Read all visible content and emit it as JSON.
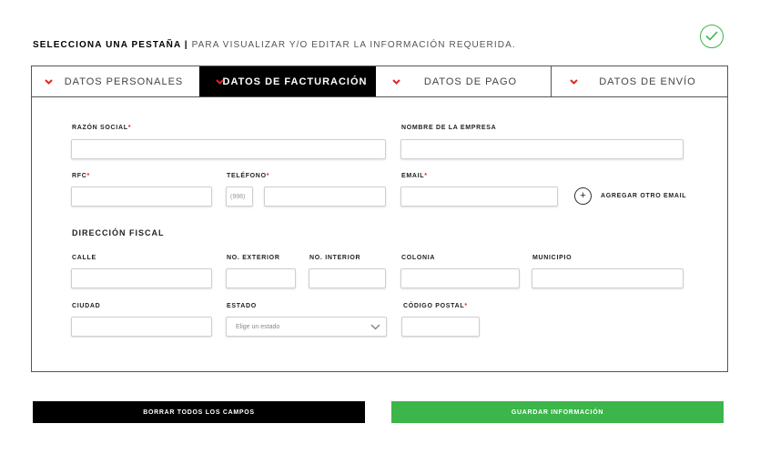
{
  "header": {
    "title": "SELECCIONA UNA PESTAÑA",
    "separator": " | ",
    "subtitle": "PARA VISUALIZAR Y/O EDITAR LA INFORMACIÓN REQUERIDA."
  },
  "tabs": [
    {
      "label": "DATOS PERSONALES",
      "active": false
    },
    {
      "label": "DATOS DE FACTURACIÓN",
      "active": true
    },
    {
      "label": "DATOS DE PAGO",
      "active": false
    },
    {
      "label": "DATOS DE ENVÍO",
      "active": false
    }
  ],
  "form": {
    "razon_social": {
      "label": "RAZÓN SOCIAL",
      "required": "*",
      "value": ""
    },
    "nombre_empresa": {
      "label": "NOMBRE DE LA EMPRESA",
      "value": ""
    },
    "rfc": {
      "label": "RFC",
      "required": "*",
      "value": ""
    },
    "telefono": {
      "label": "TELÉFONO",
      "required": "*",
      "area_placeholder": "(998)",
      "value": ""
    },
    "email": {
      "label": "EMAIL",
      "required": "*",
      "value": ""
    },
    "add_email_label": "AGREGAR OTRO EMAIL",
    "add_email_symbol": "+",
    "direccion_fiscal": {
      "title": "DIRECCIÓN FISCAL",
      "calle": {
        "label": "CALLE",
        "value": ""
      },
      "no_exterior": {
        "label": "NO. EXTERIOR",
        "value": ""
      },
      "no_interior": {
        "label": "NO. INTERIOR",
        "value": ""
      },
      "colonia": {
        "label": "COLONIA",
        "value": ""
      },
      "municipio": {
        "label": "MUNICIPIO",
        "value": ""
      },
      "ciudad": {
        "label": "CIUDAD",
        "value": ""
      },
      "estado": {
        "label": "ESTADO",
        "selected": "Elige un estado"
      },
      "codigo_postal": {
        "label": "CÓDIGO POSTAL",
        "required": "*",
        "value": ""
      }
    }
  },
  "buttons": {
    "clear": "BORRAR TODOS LOS CAMPOS",
    "save": "GUARDAR INFORMACIÓN"
  },
  "colors": {
    "accent_red": "#e02525",
    "success_green": "#3cb54a",
    "active_tab_bg": "#000000"
  },
  "icons": {
    "status": "check-circle-icon",
    "tab_chevron": "chevron-down-icon",
    "select_chevron": "chevron-down-icon"
  }
}
